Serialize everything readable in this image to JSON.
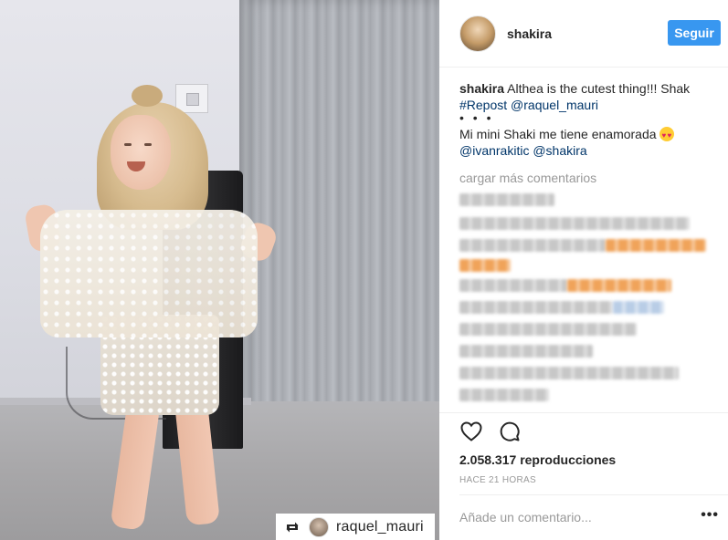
{
  "post": {
    "username": "shakira",
    "follow_label": "Seguir",
    "caption_user": "shakira",
    "caption_text": " Althea is the cutest thing!!! Shak",
    "repost_hashtag": "#Repost",
    "repost_mention": "@raquel_mauri",
    "dots": "• • •",
    "caption_line2": "Mi mini Shaki me tiene enamorada",
    "caption_emoji": "heart-eyes-emoji",
    "mention_1": "@ivanrakitic",
    "mention_2": "@shakira",
    "load_more": "cargar más comentarios",
    "views_count": "2.058.317",
    "views_label": "reproducciones",
    "timestamp": "HACE 21 HORAS",
    "comment_placeholder": "Añade un comentario...",
    "more_options": "•••"
  },
  "media": {
    "repost_username": "raquel_mauri",
    "icons": [
      "repost-icon",
      "avatar"
    ]
  },
  "actions": {
    "icons": [
      "heart-icon",
      "comment-icon"
    ]
  },
  "colors": {
    "follow_button": "#3897f0",
    "link": "#003569",
    "muted": "#999999"
  }
}
